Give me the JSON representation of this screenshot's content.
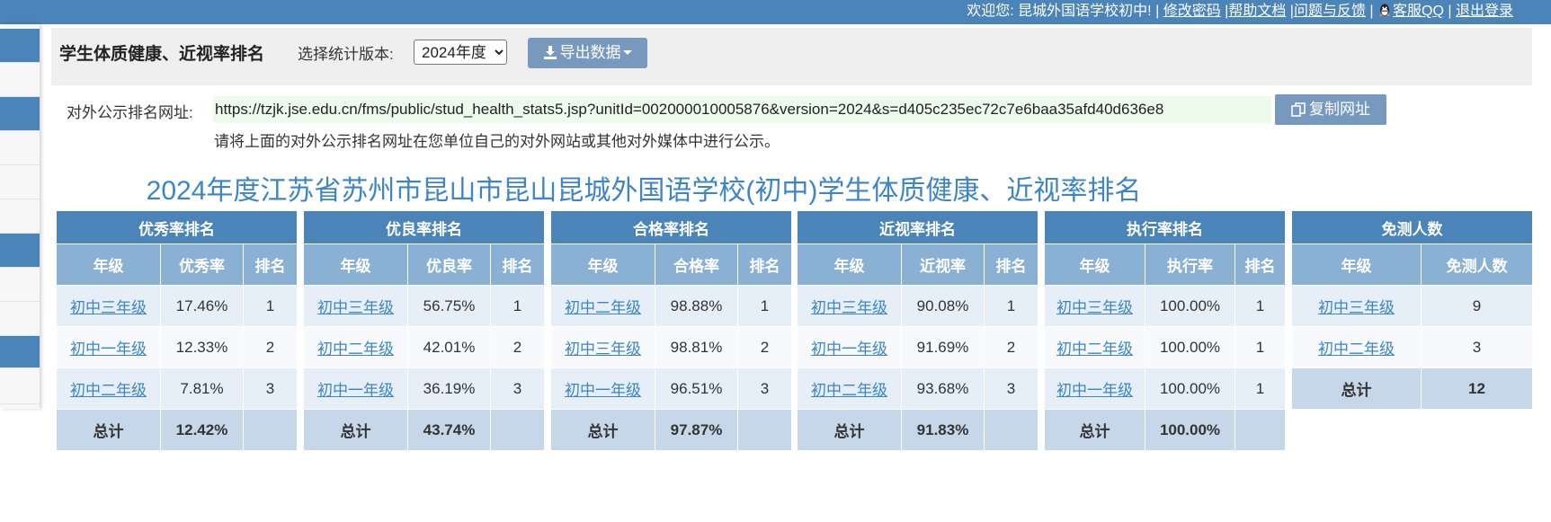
{
  "topbar": {
    "welcome": "欢迎您: 昆城外国语学校初中!",
    "sep": "|",
    "change_password": "修改密码",
    "help": "帮助文档",
    "feedback": "问题与反馈",
    "qq": "客服QQ",
    "logout": "退出登录"
  },
  "toolbar": {
    "title": "学生体质健康、近视率排名",
    "version_label": "选择统计版本:",
    "version_options": [
      "2024年度"
    ],
    "version_selected": "2024年度",
    "export_label": "导出数据"
  },
  "public": {
    "url_label": "对外公示排名网址:",
    "url": "https://tzjk.jse.edu.cn/fms/public/stud_health_stats5.jsp?unitId=002000010005876&version=2024&s=d405c235ec72c7e6baa35afd40d636e8",
    "copy_label": "复制网址",
    "hint": "请将上面的对外公示排名网址在您单位自己的对外网站或其他对外媒体中进行公示。"
  },
  "report_title": "2024年度江苏省苏州市昆山市昆山昆城外国语学校(初中)学生体质健康、近视率排名",
  "tables": [
    {
      "title": "优秀率排名",
      "col1": "年级",
      "col2": "优秀率",
      "col3": "排名",
      "rows": [
        {
          "grade": "初中三年级",
          "rate": "17.46%",
          "rank": "1"
        },
        {
          "grade": "初中一年级",
          "rate": "12.33%",
          "rank": "2"
        },
        {
          "grade": "初中二年级",
          "rate": "7.81%",
          "rank": "3"
        }
      ],
      "total_label": "总计",
      "total_value": "12.42%"
    },
    {
      "title": "优良率排名",
      "col1": "年级",
      "col2": "优良率",
      "col3": "排名",
      "rows": [
        {
          "grade": "初中三年级",
          "rate": "56.75%",
          "rank": "1"
        },
        {
          "grade": "初中二年级",
          "rate": "42.01%",
          "rank": "2"
        },
        {
          "grade": "初中一年级",
          "rate": "36.19%",
          "rank": "3"
        }
      ],
      "total_label": "总计",
      "total_value": "43.74%"
    },
    {
      "title": "合格率排名",
      "col1": "年级",
      "col2": "合格率",
      "col3": "排名",
      "rows": [
        {
          "grade": "初中二年级",
          "rate": "98.88%",
          "rank": "1"
        },
        {
          "grade": "初中三年级",
          "rate": "98.81%",
          "rank": "2"
        },
        {
          "grade": "初中一年级",
          "rate": "96.51%",
          "rank": "3"
        }
      ],
      "total_label": "总计",
      "total_value": "97.87%"
    },
    {
      "title": "近视率排名",
      "col1": "年级",
      "col2": "近视率",
      "col3": "排名",
      "rows": [
        {
          "grade": "初中三年级",
          "rate": "90.08%",
          "rank": "1"
        },
        {
          "grade": "初中一年级",
          "rate": "91.69%",
          "rank": "2"
        },
        {
          "grade": "初中二年级",
          "rate": "93.68%",
          "rank": "3"
        }
      ],
      "total_label": "总计",
      "total_value": "91.83%"
    },
    {
      "title": "执行率排名",
      "col1": "年级",
      "col2": "执行率",
      "col3": "排名",
      "rows": [
        {
          "grade": "初中三年级",
          "rate": "100.00%",
          "rank": "1"
        },
        {
          "grade": "初中二年级",
          "rate": "100.00%",
          "rank": "1"
        },
        {
          "grade": "初中一年级",
          "rate": "100.00%",
          "rank": "1"
        }
      ],
      "total_label": "总计",
      "total_value": "100.00%"
    }
  ],
  "exempt": {
    "title": "免测人数",
    "col1": "年级",
    "col2": "免测人数",
    "rows": [
      {
        "grade": "初中三年级",
        "count": "9"
      },
      {
        "grade": "初中二年级",
        "count": "3"
      }
    ],
    "total_label": "总计",
    "total_value": "12"
  },
  "colors": {
    "topbar": "#4a84b8",
    "header": "#4a84b8",
    "subheader": "#8ab0d4",
    "total_row": "#c5d7e8",
    "link": "#3d85c6",
    "url_bg": "#ecfbec"
  }
}
